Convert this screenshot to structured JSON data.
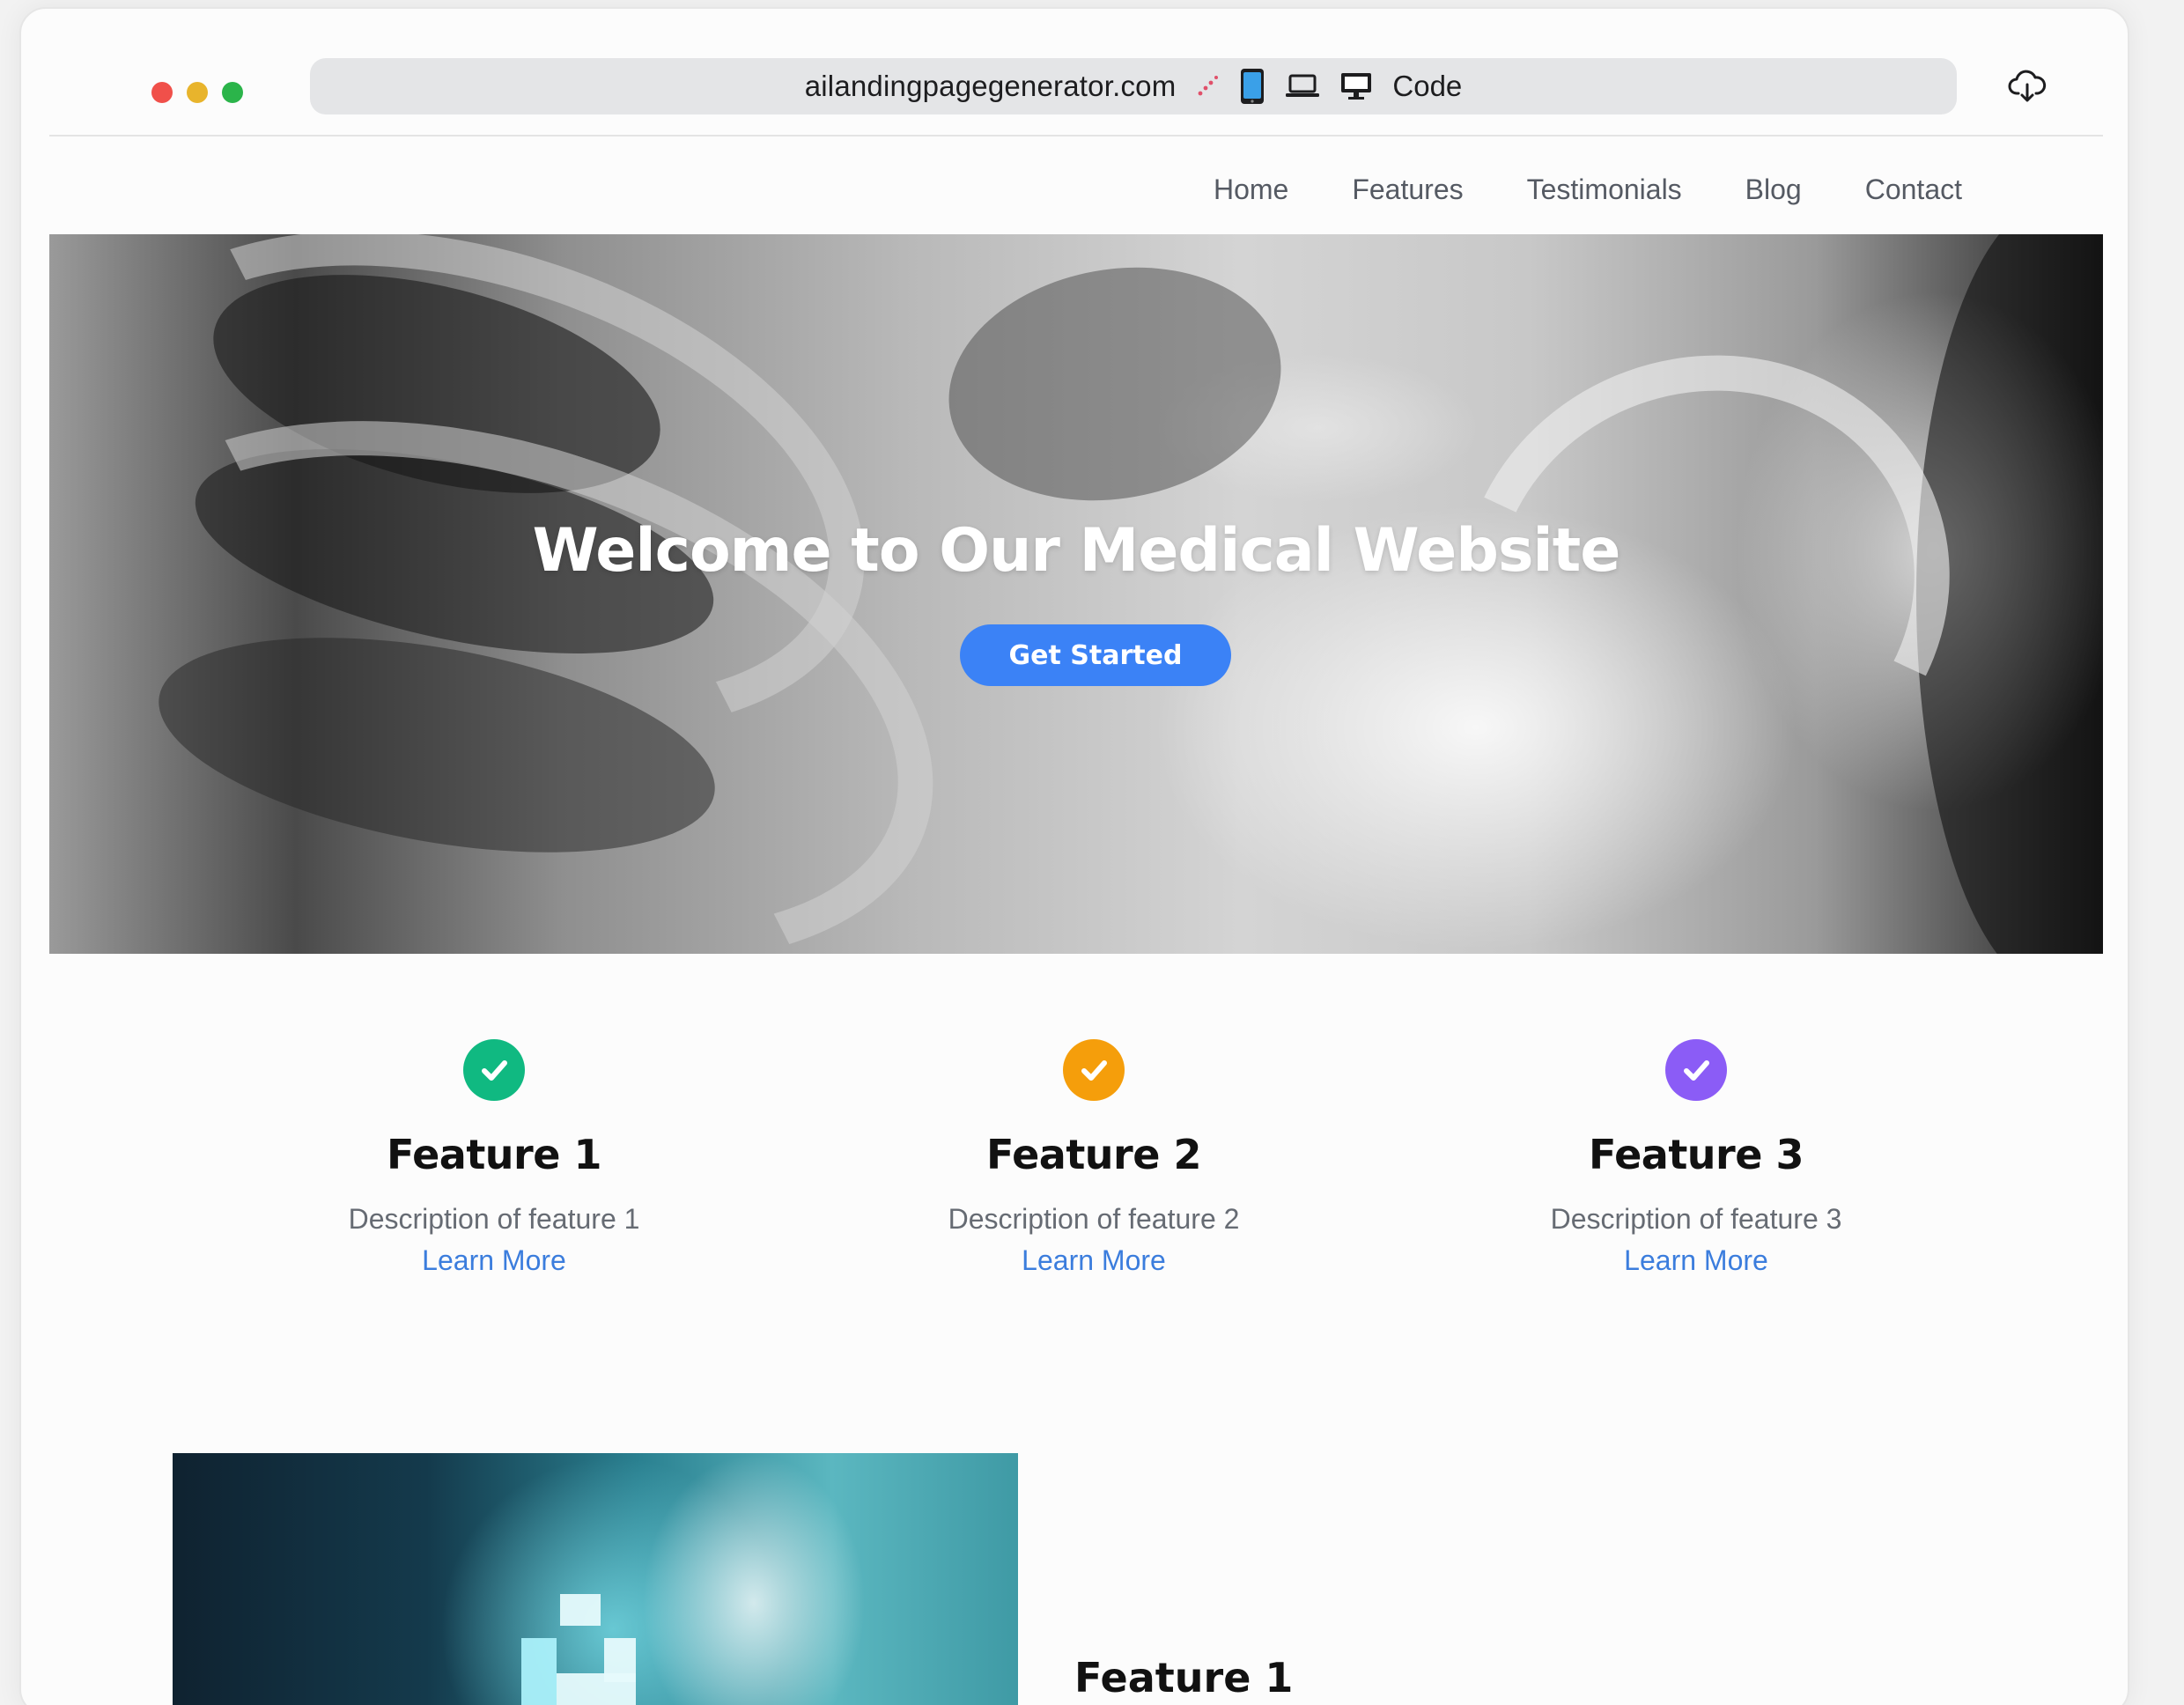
{
  "browser": {
    "url": "ailandingpagegenerator.com",
    "code_label": "Code",
    "traffic_lights": [
      "#ff5f57",
      "#febc2e",
      "#28c840"
    ],
    "toolbar_icons": [
      "magic-wand-icon",
      "mobile-icon",
      "laptop-icon",
      "desktop-icon"
    ],
    "download_icon": "cloud-download-icon"
  },
  "nav": {
    "items": [
      "Home",
      "Features",
      "Testimonials",
      "Blog",
      "Contact"
    ]
  },
  "hero": {
    "title": "Welcome to Our Medical Website",
    "cta": "Get Started",
    "accent": "#3b82f6"
  },
  "features": [
    {
      "title": "Feature 1",
      "description": "Description of feature 1",
      "link": "Learn More",
      "color": "#10b981"
    },
    {
      "title": "Feature 2",
      "description": "Description of feature 2",
      "link": "Learn More",
      "color": "#f59e0b"
    },
    {
      "title": "Feature 3",
      "description": "Description of feature 3",
      "link": "Learn More",
      "color": "#8b5cf6"
    }
  ],
  "detail": {
    "title": "Feature 1"
  }
}
